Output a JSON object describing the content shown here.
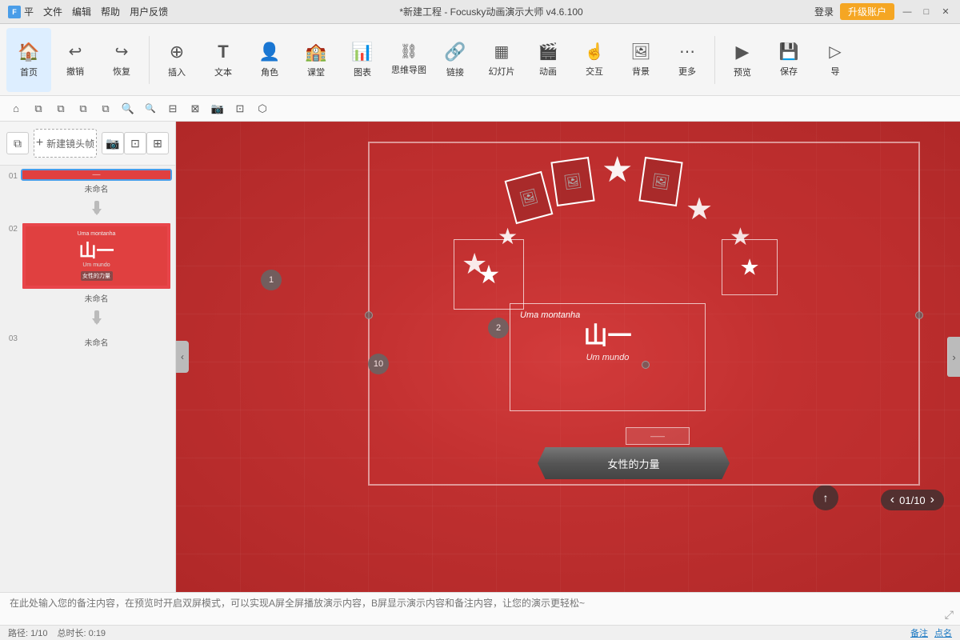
{
  "app": {
    "title": "*新建工程 - Focusky动画演示大师 v4.6.100",
    "logo": "F",
    "menus": [
      "平",
      "文件",
      "编辑",
      "帮助",
      "用户反馈"
    ],
    "login": "登录",
    "upgrade": "升级账户",
    "win_min": "—",
    "win_max": "□",
    "win_close": "✕"
  },
  "toolbar": {
    "items": [
      {
        "id": "home",
        "icon": "🏠",
        "label": "首页",
        "active": true
      },
      {
        "id": "undo",
        "icon": "↩",
        "label": "撤销"
      },
      {
        "id": "redo",
        "icon": "↪",
        "label": "恢复"
      },
      {
        "id": "insert",
        "icon": "⊕",
        "label": "插入"
      },
      {
        "id": "text",
        "icon": "T",
        "label": "文本"
      },
      {
        "id": "role",
        "icon": "👤",
        "label": "角色"
      },
      {
        "id": "class",
        "icon": "🎓",
        "label": "课堂"
      },
      {
        "id": "chart",
        "icon": "📊",
        "label": "图表"
      },
      {
        "id": "mindmap",
        "icon": "🔗",
        "label": "思维导图"
      },
      {
        "id": "link",
        "icon": "🔗",
        "label": "链接"
      },
      {
        "id": "slide",
        "icon": "🎞",
        "label": "幻灯片"
      },
      {
        "id": "animate",
        "icon": "🎬",
        "label": "动画"
      },
      {
        "id": "interact",
        "icon": "☝",
        "label": "交互"
      },
      {
        "id": "bg",
        "icon": "🖼",
        "label": "背景"
      },
      {
        "id": "more",
        "icon": "⋯",
        "label": "更多"
      },
      {
        "id": "preview",
        "icon": "▶",
        "label": "预览"
      },
      {
        "id": "save",
        "icon": "💾",
        "label": "保存"
      },
      {
        "id": "nav",
        "icon": "▶",
        "label": "导"
      }
    ]
  },
  "action_toolbar": {
    "buttons": [
      "⌂",
      "⧉",
      "⧉",
      "⧉",
      "⧉",
      "🔍+",
      "🔍-",
      "⊟",
      "⊠",
      "📸",
      "⊡",
      "⬡"
    ]
  },
  "sidebar": {
    "new_slide": "新建镜头帧",
    "copy_btn": "复制帧",
    "photo_btn": "📷",
    "btn3": "⊡",
    "btn4": "⊞",
    "slides": [
      {
        "num": "01",
        "label": "未命名",
        "active": true
      },
      {
        "num": "02",
        "label": "未命名"
      },
      {
        "num": "03",
        "label": "未命名"
      }
    ]
  },
  "canvas": {
    "slide_content": {
      "mountain_label": "Uma montanha",
      "main_text": "山一",
      "world_label": "Um mundo",
      "banner_text": "女性的力量",
      "num_circles": [
        "1",
        "2",
        "10"
      ]
    }
  },
  "slide2": {
    "title": "Uma montanha",
    "main": "山一",
    "sub": "Um mundo"
  },
  "bottom": {
    "notes_placeholder": "在此处输入您的备注内容，在预览时开启双屏模式，可以实现A屏全屏播放演示内容，B屏显示演示内容和备注内容，让您的演示更轻松~",
    "path": "路径: 1/10",
    "duration": "总时长: 0:19",
    "notes_link": "备注",
    "name_link": "点名",
    "page_info": "01/10"
  }
}
